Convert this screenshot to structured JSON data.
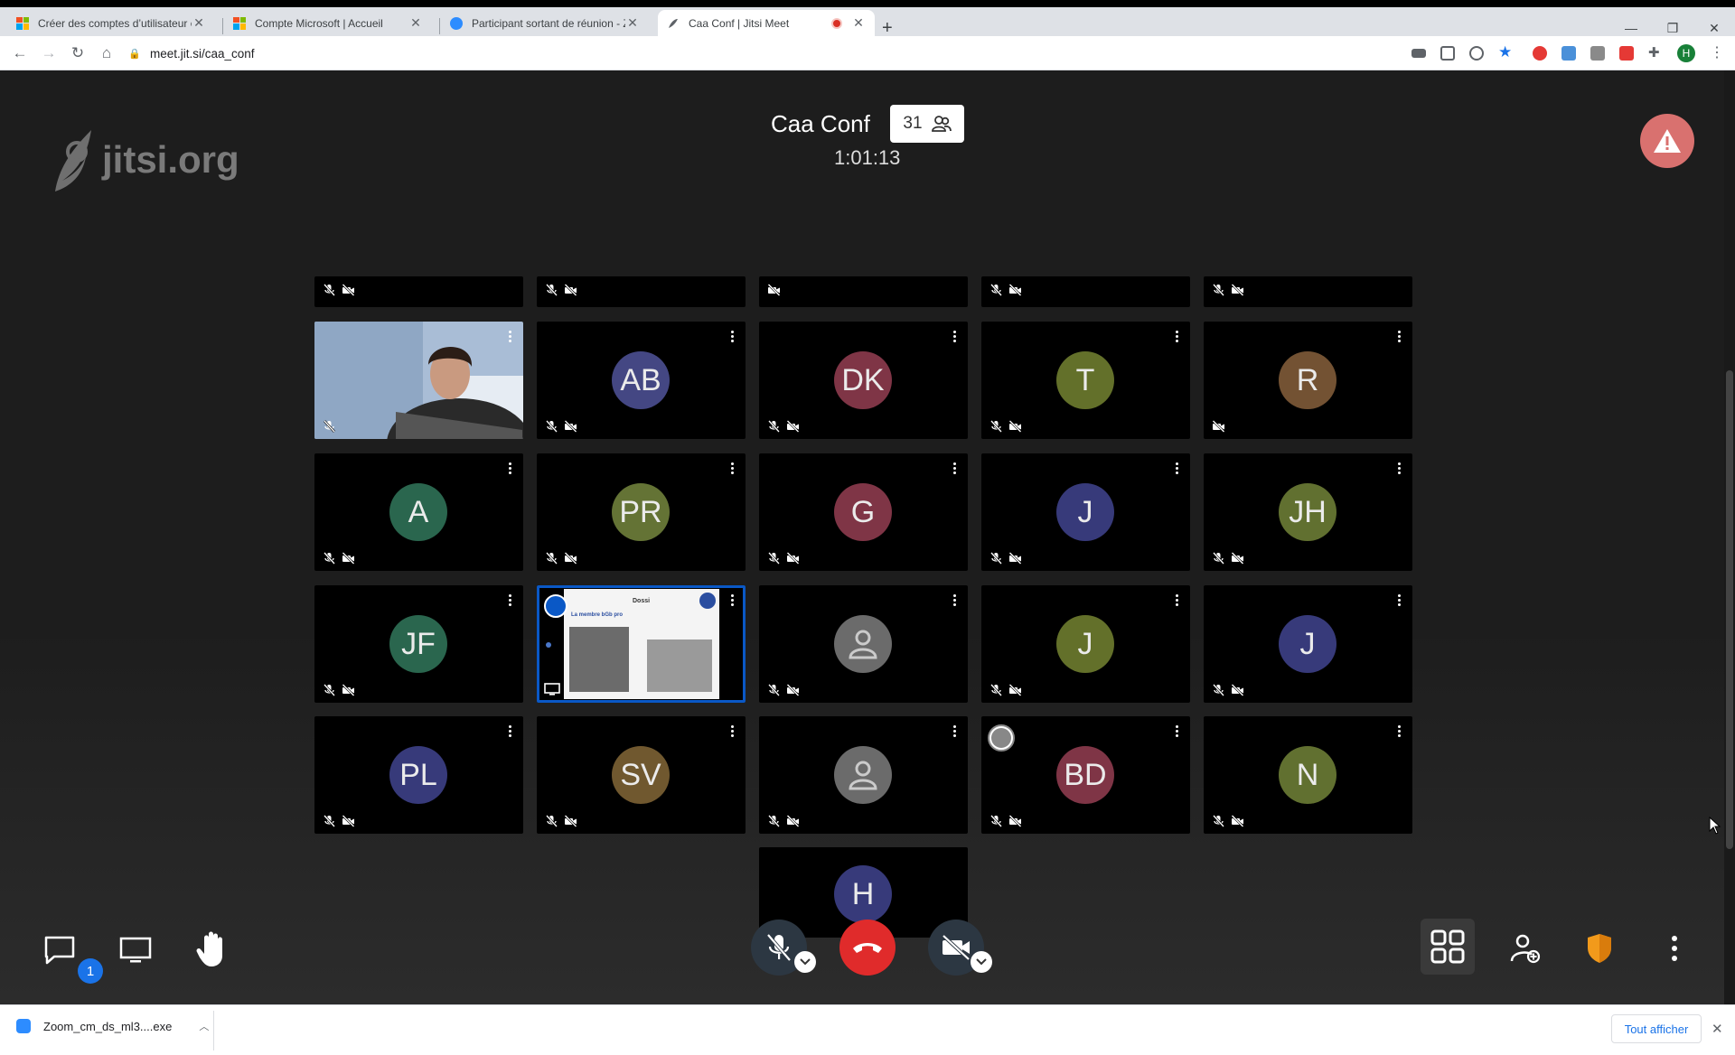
{
  "browser": {
    "tabs": [
      {
        "title": "Créer des comptes d’utilisateur e",
        "favicon": "microsoft-icon"
      },
      {
        "title": "Compte Microsoft | Accueil",
        "favicon": "microsoft-icon"
      },
      {
        "title": "Participant sortant de réunion - Z",
        "favicon": "zoom-icon"
      },
      {
        "title": "Caa Conf | Jitsi Meet",
        "favicon": "jitsi-icon",
        "active": true,
        "recording": true
      }
    ],
    "url": "meet.jit.si/caa_conf"
  },
  "meeting": {
    "logo_text": "jitsi.org",
    "title": "Caa Conf",
    "participant_count": "31",
    "timer": "1:01:13"
  },
  "tiles": [
    {
      "initials": "",
      "color": "#000000",
      "partial": true,
      "mic_muted": true,
      "cam_off": true
    },
    {
      "initials": "",
      "color": "#000000",
      "partial": true,
      "mic_muted": true,
      "cam_off": true
    },
    {
      "initials": "",
      "color": "#000000",
      "partial": true,
      "mic_muted": false,
      "cam_off": true
    },
    {
      "initials": "",
      "color": "#000000",
      "partial": true,
      "mic_muted": true,
      "cam_off": true
    },
    {
      "initials": "",
      "color": "#000000",
      "partial": true,
      "mic_muted": true,
      "cam_off": true
    },
    {
      "initials": "",
      "video": true,
      "mic_muted": true,
      "cam_off": false
    },
    {
      "initials": "AB",
      "color": "#4a4e8f",
      "mic_muted": true,
      "cam_off": true
    },
    {
      "initials": "DK",
      "color": "#8a3a4c",
      "mic_muted": true,
      "cam_off": true
    },
    {
      "initials": "T",
      "color": "#6c7a2e",
      "mic_muted": true,
      "cam_off": true
    },
    {
      "initials": "R",
      "color": "#7d5a38",
      "mic_muted": false,
      "cam_off": true
    },
    {
      "initials": "A",
      "color": "#2e6f55",
      "mic_muted": true,
      "cam_off": true
    },
    {
      "initials": "PR",
      "color": "#6d7d3a",
      "mic_muted": true,
      "cam_off": true
    },
    {
      "initials": "G",
      "color": "#8a3a4c",
      "mic_muted": true,
      "cam_off": true
    },
    {
      "initials": "J",
      "color": "#3c3f85",
      "mic_muted": true,
      "cam_off": true
    },
    {
      "initials": "JH",
      "color": "#6a7a35",
      "mic_muted": true,
      "cam_off": true
    },
    {
      "initials": "JF",
      "color": "#2e6f55",
      "mic_muted": true,
      "cam_off": true
    },
    {
      "initials": "",
      "screenshare": true,
      "speaking": true,
      "slide_title": "Dossi",
      "slide_heading": "La membre bGb pro"
    },
    {
      "initials": "",
      "generic": true,
      "mic_muted": true,
      "cam_off": true
    },
    {
      "initials": "J",
      "color": "#6c7a2e",
      "mic_muted": true,
      "cam_off": true
    },
    {
      "initials": "J",
      "color": "#3c3f85",
      "mic_muted": true,
      "cam_off": true
    },
    {
      "initials": "PL",
      "color": "#3c3f85",
      "mic_muted": true,
      "cam_off": true
    },
    {
      "initials": "SV",
      "color": "#7a6033",
      "mic_muted": true,
      "cam_off": true
    },
    {
      "initials": "",
      "generic": true,
      "mic_muted": true,
      "cam_off": true
    },
    {
      "initials": "BD",
      "color": "#8a3a4c",
      "mic_muted": true,
      "cam_off": true,
      "signal": true
    },
    {
      "initials": "N",
      "color": "#6a7a35",
      "mic_muted": true,
      "cam_off": true
    },
    {
      "initials": "H",
      "color": "#3c3f85",
      "partial_bottom": true
    }
  ],
  "toolbar": {
    "chat_badge": "1",
    "colors": {
      "hangup": "#e02b2b",
      "active_bg": "#3a3a3a"
    }
  },
  "downloads": {
    "file": "Zoom_cm_ds_ml3....exe",
    "show_all": "Tout afficher"
  }
}
